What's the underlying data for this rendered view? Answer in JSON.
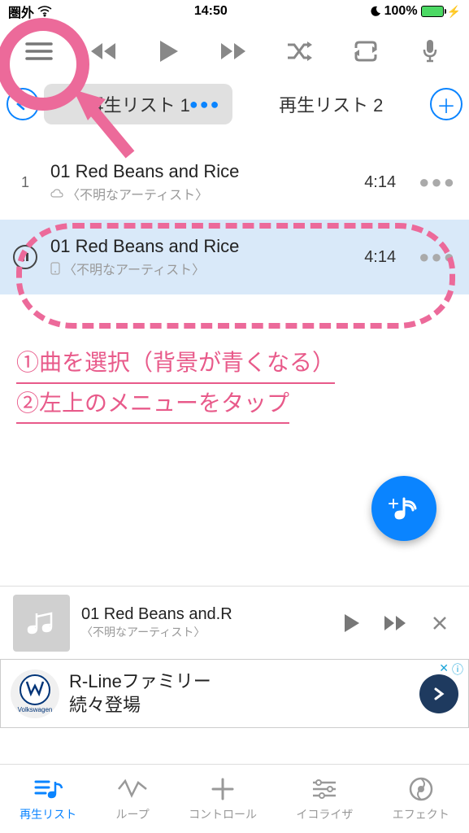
{
  "status": {
    "carrier": "圏外",
    "time": "14:50",
    "battery": "100%"
  },
  "tabs": {
    "t1": "再生リスト 1",
    "t2": "再生リスト 2"
  },
  "tracks": [
    {
      "idx": "1",
      "title": "01 Red Beans and Rice",
      "artist": "〈不明なアーティスト〉",
      "duration": "4:14"
    },
    {
      "idx": "",
      "title": "01 Red Beans and Rice",
      "artist": "〈不明なアーティスト〉",
      "duration": "4:14"
    }
  ],
  "annotation": {
    "line1": "①曲を選択（背景が青くなる）",
    "line2": "②左上のメニューをタップ"
  },
  "now_playing": {
    "title": "01 Red Beans and.R",
    "artist": "〈不明なアーティスト〉"
  },
  "ad": {
    "brand": "Volkswagen",
    "line1": "R-Lineファミリー",
    "line2": "続々登場"
  },
  "nav": {
    "n1": "再生リスト",
    "n2": "ループ",
    "n3": "コントロール",
    "n4": "イコライザ",
    "n5": "エフェクト"
  }
}
